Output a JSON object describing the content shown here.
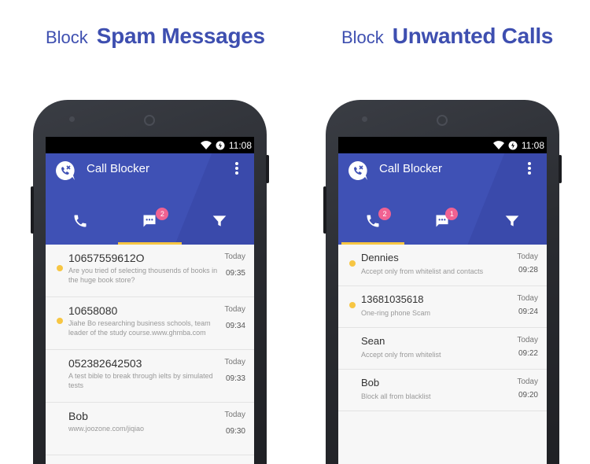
{
  "colors": {
    "primary": "#3f51b5",
    "indicator": "#f7c643",
    "badge": "#f06292",
    "headline": "#3e4fb0"
  },
  "left": {
    "headline": {
      "prefix": "Block",
      "emphasis": "Spam Messages"
    },
    "phone": {
      "status": {
        "time": "11:08"
      },
      "app": {
        "title": "Call Blocker"
      },
      "tabs": [
        {
          "icon": "phone-icon",
          "badge": ""
        },
        {
          "icon": "message-icon",
          "badge": "2",
          "active": true
        },
        {
          "icon": "filter-icon",
          "badge": ""
        }
      ],
      "rows": [
        {
          "title": "10657559612O",
          "subtitle": "Are you tried of selecting thousends of books in the huge book store?",
          "day": "Today",
          "time": "09:35",
          "unread": true
        },
        {
          "title": "10658080",
          "subtitle": "Jiahe Bo researching business schools, team leader of the study course.www.ghmba.com",
          "day": "Today",
          "time": "09:34",
          "unread": true
        },
        {
          "title": "052382642503",
          "subtitle": "A test bible to break through ielts by simulated tests",
          "day": "Today",
          "time": "09:33",
          "unread": false
        },
        {
          "title": "Bob",
          "subtitle": "www.joozone.com/jiqiao",
          "day": "Today",
          "time": "09:30",
          "unread": false
        }
      ]
    }
  },
  "right": {
    "headline": {
      "prefix": "Block",
      "emphasis": "Unwanted Calls"
    },
    "phone": {
      "status": {
        "time": "11:08"
      },
      "app": {
        "title": "Call Blocker"
      },
      "tabs": [
        {
          "icon": "phone-icon",
          "badge": "2",
          "active": true
        },
        {
          "icon": "message-icon",
          "badge": "1"
        },
        {
          "icon": "filter-icon",
          "badge": ""
        }
      ],
      "rows": [
        {
          "title": "Dennies",
          "subtitle": "Accept only from whitelist and contacts",
          "day": "Today",
          "time": "09:28",
          "unread": true
        },
        {
          "title": "13681035618",
          "subtitle": "One-ring phone Scam",
          "day": "Today",
          "time": "09:24",
          "unread": true
        },
        {
          "title": "Sean",
          "subtitle": "Accept only from whitelist",
          "day": "Today",
          "time": "09:22",
          "unread": false
        },
        {
          "title": "Bob",
          "subtitle": "Block all from blacklist",
          "day": "Today",
          "time": "09:20",
          "unread": false
        }
      ]
    }
  }
}
